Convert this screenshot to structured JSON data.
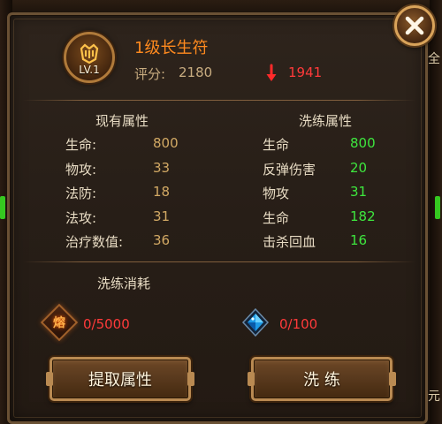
{
  "item": {
    "name": "1级长生符",
    "level_label": "LV.1",
    "score_label": "评分:",
    "score_value": "2180",
    "score_delta": "1941"
  },
  "current_attributes": {
    "header": "现有属性",
    "rows": [
      {
        "name": "生命:",
        "value": "800"
      },
      {
        "name": "物攻:",
        "value": "33"
      },
      {
        "name": "法防:",
        "value": "18"
      },
      {
        "name": "法攻:",
        "value": "31"
      },
      {
        "name": "治疗数值:",
        "value": "36"
      }
    ]
  },
  "refined_attributes": {
    "header": "洗练属性",
    "rows": [
      {
        "name": "生命",
        "value": "800"
      },
      {
        "name": "反弹伤害",
        "value": "20"
      },
      {
        "name": "物攻",
        "value": "31"
      },
      {
        "name": "生命",
        "value": "182"
      },
      {
        "name": "击杀回血",
        "value": "16"
      }
    ]
  },
  "cost": {
    "title": "洗练消耗",
    "fire_icon_char": "熔",
    "fire_amount": "0/5000",
    "gem_amount": "0/100"
  },
  "buttons": {
    "extract": "提取属性",
    "refine": "洗 练"
  },
  "edge": {
    "right_top_char": "全",
    "right_bottom_char": "元",
    "left_green": "1",
    "right_green": "1"
  },
  "colors": {
    "title": "#ff8a1e",
    "delta": "#ff3a3a",
    "refined_value": "#3ee63e",
    "current_value": "#d2a964"
  }
}
